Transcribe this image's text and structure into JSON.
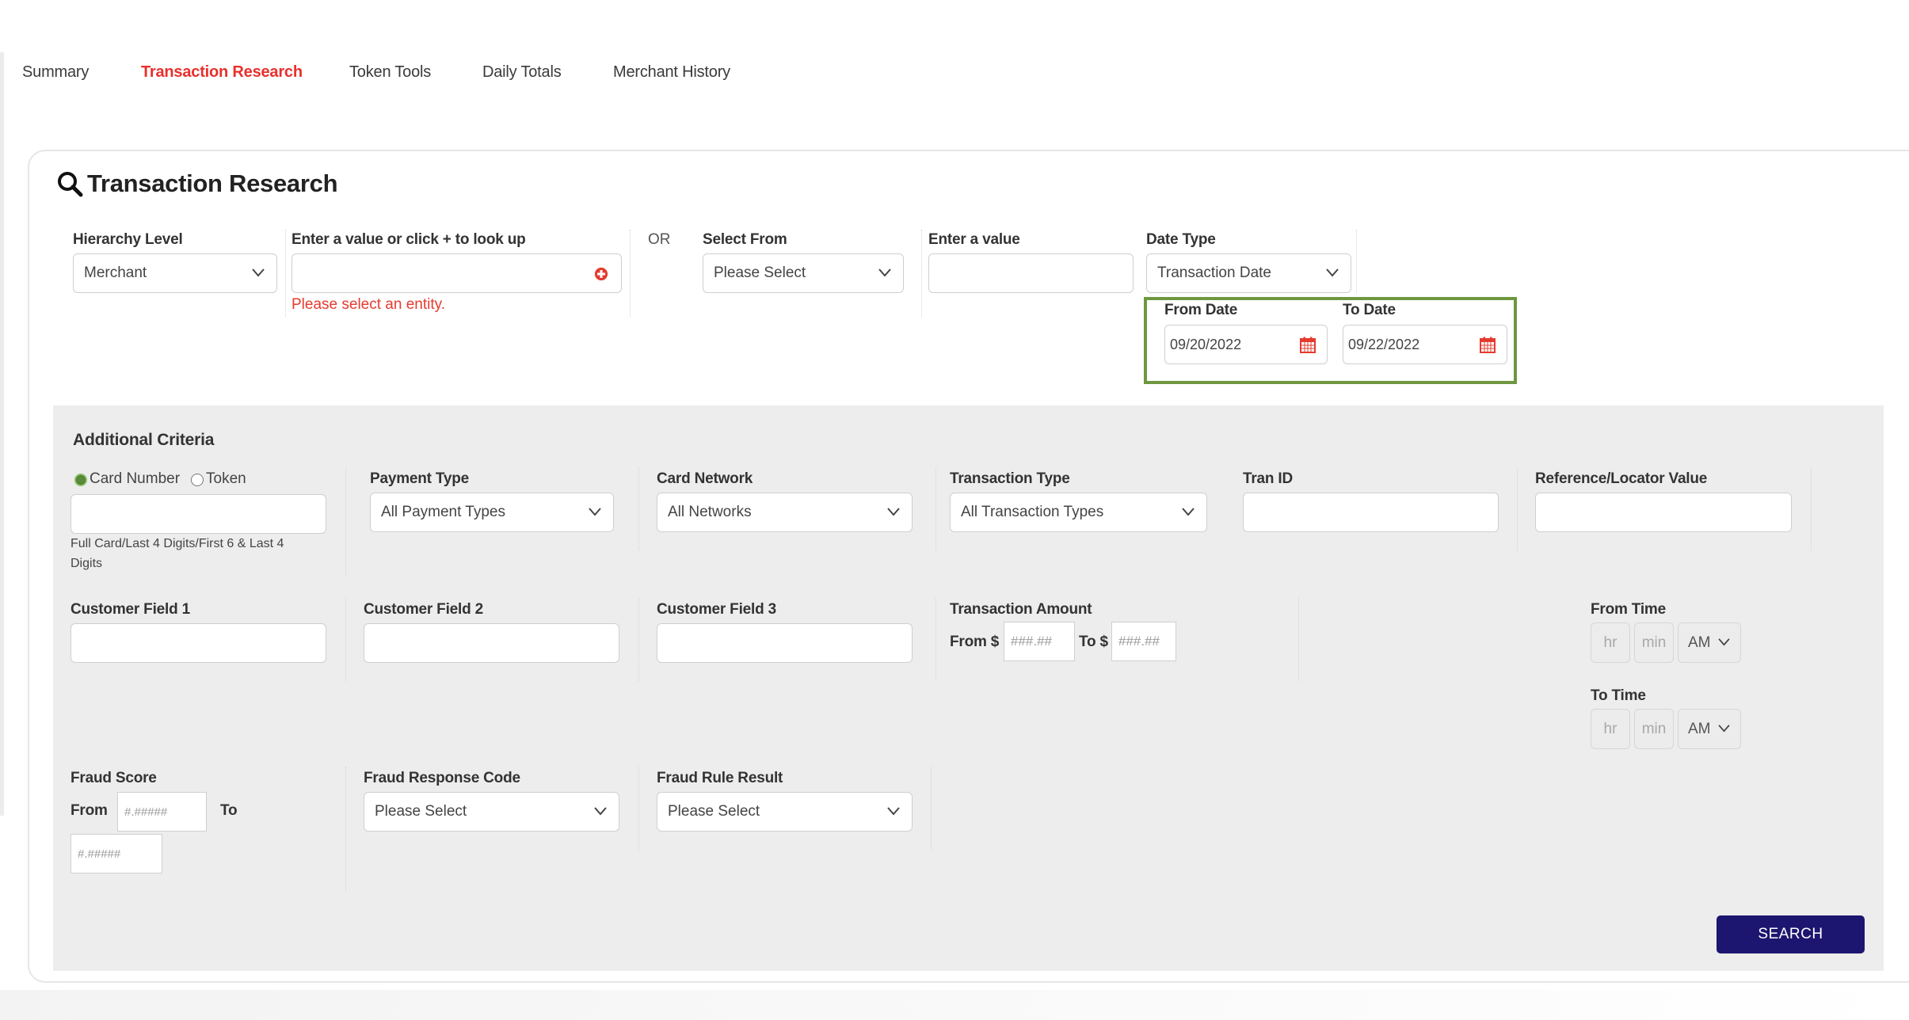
{
  "tabs": [
    {
      "label": "Summary",
      "active": false
    },
    {
      "label": "Transaction Research",
      "active": true
    },
    {
      "label": "Token Tools",
      "active": false
    },
    {
      "label": "Daily Totals",
      "active": false
    },
    {
      "label": "Merchant History",
      "active": false
    }
  ],
  "colors": {
    "active_tab": "#e8302c",
    "error": "#e53b2f",
    "highlight_border": "#6e9740",
    "search_button": "#1d1670",
    "panel_bg": "#ededed"
  },
  "page": {
    "title": "Transaction Research",
    "title_icon": "search-icon"
  },
  "entity": {
    "hierarchy_label": "Hierarchy Level",
    "hierarchy_value": "Merchant",
    "lookup_label": "Enter a value or click + to look up",
    "lookup_value": "",
    "lookup_icon": "plus-circle-icon",
    "error": "Please select an entity.",
    "or_text": "OR",
    "select_from_label": "Select From",
    "select_from_value": "Please Select",
    "enter_value_label": "Enter a value",
    "enter_value_value": "",
    "date_type_label": "Date Type",
    "date_type_value": "Transaction Date"
  },
  "dates": {
    "from_label": "From Date",
    "from_value": "09/20/2022",
    "to_label": "To Date",
    "to_value": "09/22/2022",
    "icon": "calendar-icon"
  },
  "additional": {
    "heading": "Additional Criteria",
    "card_radio_label": "Card Number",
    "token_radio_label": "Token",
    "card_radio_selected": "Card Number",
    "card_value": "",
    "card_helper_line1": "Full Card/Last 4 Digits/First 6 & Last 4",
    "card_helper_line2": "Digits",
    "payment_type_label": "Payment Type",
    "payment_type_value": "All Payment Types",
    "card_network_label": "Card Network",
    "card_network_value": "All Networks",
    "transaction_type_label": "Transaction Type",
    "transaction_type_value": "All Transaction Types",
    "tran_id_label": "Tran ID",
    "tran_id_value": "",
    "reference_label": "Reference/Locator Value",
    "reference_value": "",
    "customer_field_1_label": "Customer Field 1",
    "customer_field_2_label": "Customer Field 2",
    "customer_field_3_label": "Customer Field 3",
    "amount_label": "Transaction Amount",
    "amount_from_label": "From $",
    "amount_to_label": "To $",
    "amount_placeholder": "###.##",
    "from_time_label": "From Time",
    "to_time_label": "To Time",
    "hr_placeholder": "hr",
    "min_placeholder": "min",
    "from_ampm": "AM",
    "to_ampm": "AM",
    "fraud_score_label": "Fraud Score",
    "fraud_from_label": "From",
    "fraud_to_label": "To",
    "fraud_placeholder": "#.#####",
    "fraud_response_label": "Fraud Response Code",
    "fraud_response_value": "Please Select",
    "fraud_rule_label": "Fraud Rule Result",
    "fraud_rule_value": "Please Select"
  },
  "search_button": "SEARCH"
}
